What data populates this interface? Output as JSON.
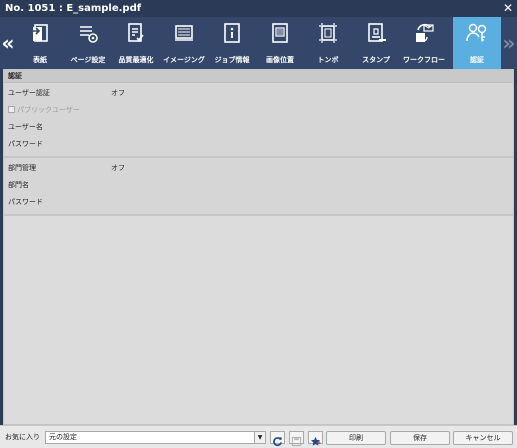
{
  "window": {
    "title": "No. 1051 :  E_sample.pdf",
    "close_symbol": "✕"
  },
  "toolbar": {
    "prev_symbol": "«",
    "next_symbol": "»",
    "tabs": [
      {
        "label": "表紙",
        "icon": "cover-icon"
      },
      {
        "label": "ページ設定",
        "icon": "page-setup-icon"
      },
      {
        "label": "品質最適化",
        "icon": "quality-optimize-icon"
      },
      {
        "label": "イメージング",
        "icon": "imaging-icon"
      },
      {
        "label": "ジョブ情報",
        "icon": "job-info-icon"
      },
      {
        "label": "画像位置",
        "icon": "image-position-icon"
      },
      {
        "label": "トンボ",
        "icon": "crop-marks-icon"
      },
      {
        "label": "スタンプ",
        "icon": "stamp-icon"
      },
      {
        "label": "ワークフロー",
        "icon": "workflow-icon"
      },
      {
        "label": "認証",
        "icon": "authentication-icon",
        "active": true
      }
    ],
    "active_color": "#5aaee0"
  },
  "auth": {
    "section_title": "認証",
    "user_auth_label": "ユーザー認証",
    "user_auth_value": "オフ",
    "public_user_label": "パブリックユーザー",
    "public_user_checked": false,
    "username_label": "ユーザー名",
    "password_label": "パスワード",
    "dept_label": "部門管理",
    "dept_value": "オフ",
    "dept_name_label": "部門名",
    "dept_password_label": "パスワード"
  },
  "footer": {
    "favorites_label": "お気に入り",
    "favorites_value": "元の設定",
    "print_label": "印刷",
    "save_label": "保存",
    "cancel_label": "キャンセル"
  }
}
